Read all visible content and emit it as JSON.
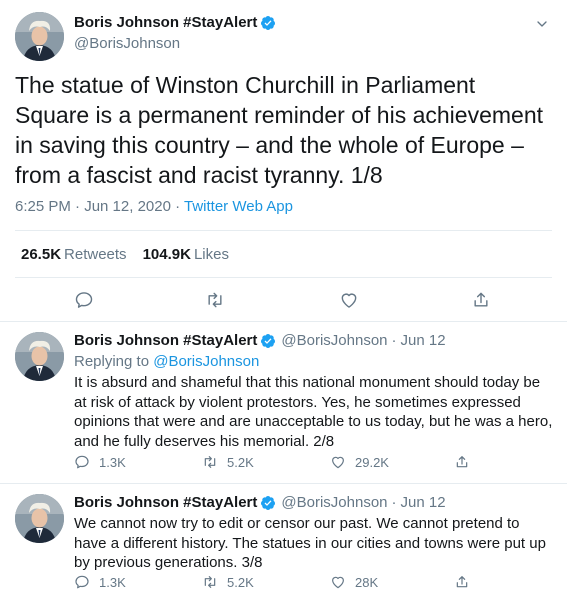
{
  "main_tweet": {
    "display_name": "Boris Johnson #StayAlert",
    "handle": "@BorisJohnson",
    "text": "The statue of Winston Churchill in Parliament Square is a permanent reminder of his achievement in saving this country – and the whole of Europe – from a fascist and racist tyranny. 1/8",
    "time": "6:25 PM · Jun 12, 2020 · ",
    "source": "Twitter Web App",
    "retweets_count": "26.5K",
    "retweets_label": "Retweets",
    "likes_count": "104.9K",
    "likes_label": "Likes"
  },
  "replies": [
    {
      "display_name": "Boris Johnson #StayAlert",
      "handle": "@BorisJohnson",
      "separator": "·",
      "date": "Jun 12",
      "replying_prefix": "Replying to ",
      "replying_to": "@BorisJohnson",
      "text": "It is absurd and shameful that this national monument should today be at risk of attack by violent protestors. Yes, he sometimes expressed opinions that were and are unacceptable to us today, but he was a hero, and he fully deserves his memorial. 2/8",
      "reply_count": "1.3K",
      "retweet_count": "5.2K",
      "like_count": "29.2K"
    },
    {
      "display_name": "Boris Johnson #StayAlert",
      "handle": "@BorisJohnson",
      "separator": "·",
      "date": "Jun 12",
      "text": "We cannot now try to edit or censor our past. We cannot pretend to have a different history. The statues in our cities and towns were put up by previous generations. 3/8",
      "reply_count": "1.3K",
      "retweet_count": "5.2K",
      "like_count": "28K"
    }
  ],
  "icons": {
    "verified": "verified-badge-icon",
    "caret": "chevron-down-icon",
    "reply": "comment-icon",
    "retweet": "retweet-icon",
    "like": "heart-icon",
    "share": "share-icon"
  },
  "colors": {
    "accent": "#1b95e0",
    "verified": "#1da1f2",
    "secondary_text": "#657786",
    "divider": "#e6ecf0"
  }
}
